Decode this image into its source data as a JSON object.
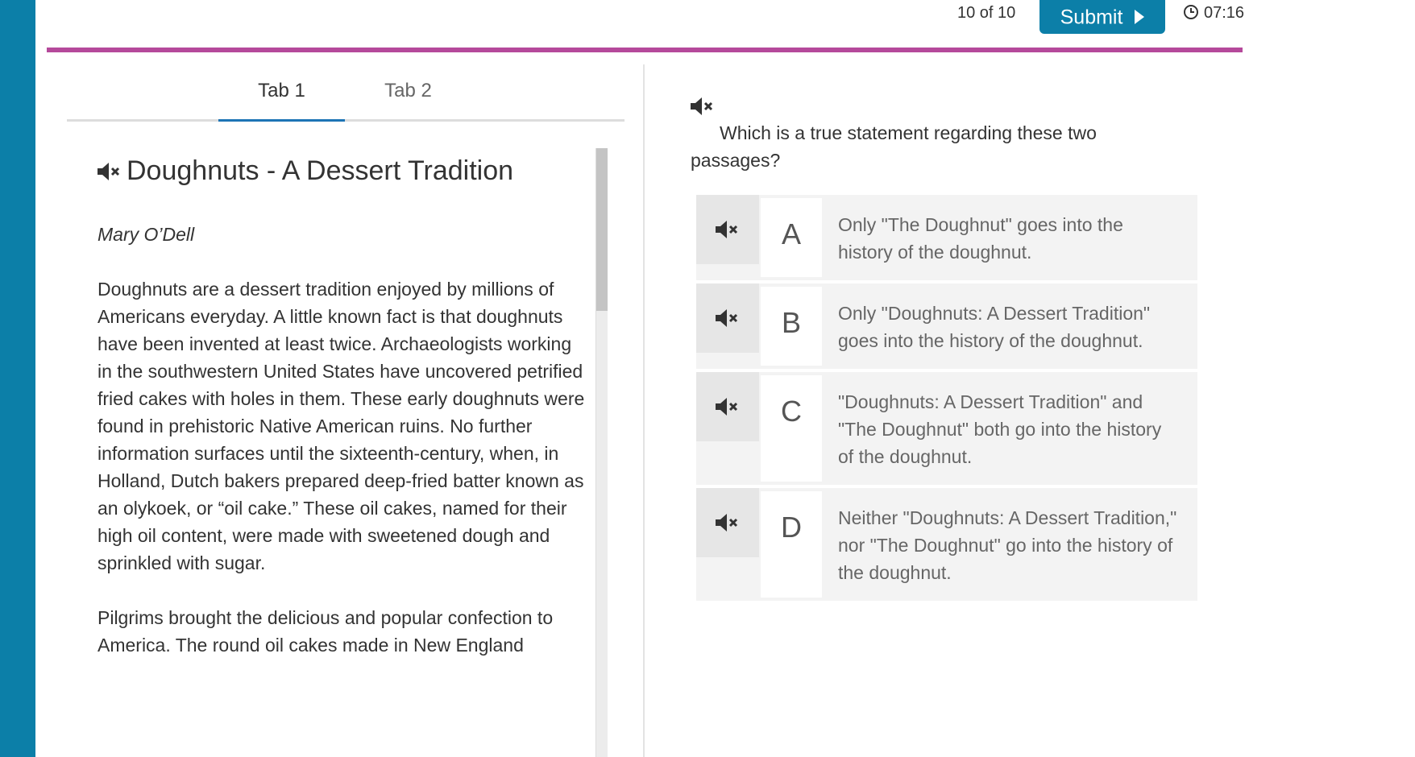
{
  "header": {
    "progress": "10 of 10",
    "submit_label": "Submit",
    "timer": "07:16"
  },
  "tabs": [
    {
      "label": "Tab 1",
      "active": true
    },
    {
      "label": "Tab 2",
      "active": false
    }
  ],
  "passage": {
    "title": "Doughnuts - A Dessert Tradition",
    "author": "Mary O’Dell",
    "paragraphs": [
      "Doughnuts are a dessert tradition enjoyed by millions of Americans everyday. A little known fact is that doughnuts have been invented at least twice. Archaeologists working in the southwestern United States have uncovered petrified fried cakes with holes in them. These early doughnuts were found in prehistoric Native American ruins. No further information surfaces until the sixteenth-century, when, in Holland, Dutch bakers prepared deep-fried batter known as an olykoek, or “oil cake.” These oil cakes, named for their high oil content, were made with sweetened dough and sprinkled with sugar.",
      "Pilgrims brought the delicious and popular confection to America. The round oil cakes made in New England"
    ]
  },
  "question": {
    "text": "Which is a true statement regarding these two passages?",
    "answers": [
      {
        "letter": "A",
        "text": "Only \"The Doughnut\" goes into the history of the doughnut."
      },
      {
        "letter": "B",
        "text": "Only \"Doughnuts: A Dessert Tradition\" goes into the history of the doughnut."
      },
      {
        "letter": "C",
        "text": "\"Doughnuts: A Dessert Tradition\" and \"The Doughnut\" both go into the history of the doughnut."
      },
      {
        "letter": "D",
        "text": "Neither \"Doughnuts: A Dessert Tradition,\" nor \"The Doughnut\" go into the history of the doughnut."
      }
    ]
  },
  "icons": {
    "audio": "speaker-muted-icon",
    "submit": "play-triangle-icon",
    "timer": "clock-icon"
  },
  "colors": {
    "sidebar": "#0c7fa8",
    "submit_button": "#0c7fa8",
    "accent_line": "#b5499b",
    "active_tab_underline": "#1d74b5"
  }
}
